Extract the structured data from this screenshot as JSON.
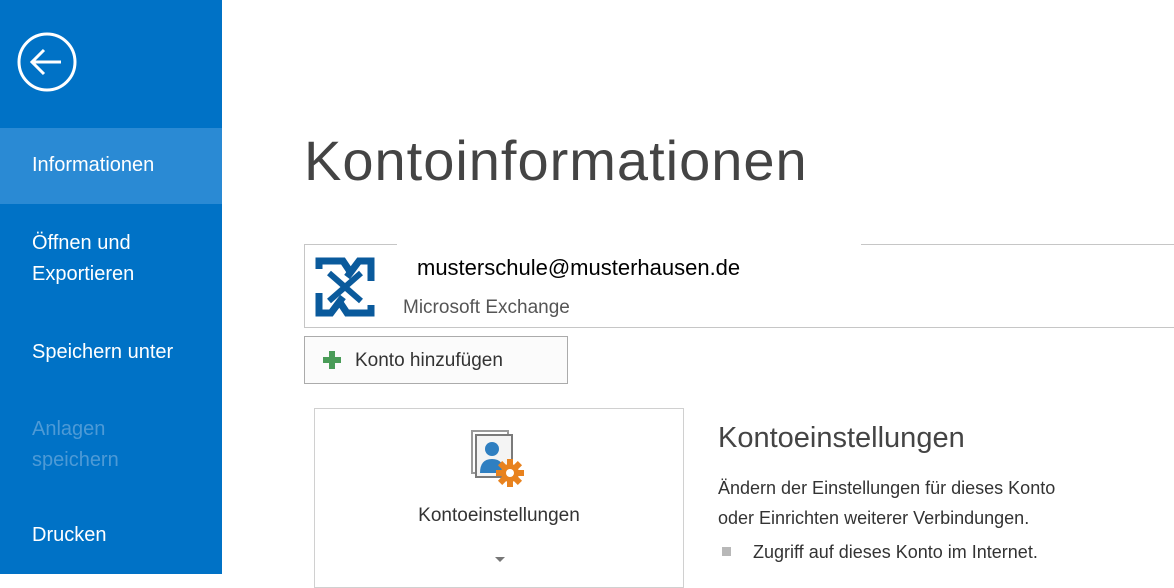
{
  "nav": {
    "back_label": "Zurück",
    "items": [
      {
        "label": "Informationen",
        "selected": true,
        "enabled": true
      },
      {
        "line1": "Öffnen und",
        "line2": "Exportieren",
        "enabled": true
      },
      {
        "label": "Speichern unter",
        "enabled": true
      },
      {
        "line1": "Anlagen",
        "line2": "speichern",
        "enabled": false
      },
      {
        "label": "Drucken",
        "enabled": true
      }
    ]
  },
  "main": {
    "title": "Kontoinformationen",
    "account": {
      "email": "musterschule@musterhausen.de",
      "type": "Microsoft Exchange"
    },
    "add_account_label": "Konto hinzufügen",
    "settings_tile_label": "Kontoeinstellungen",
    "settings_section": {
      "title": "Kontoeinstellungen",
      "description_line1": "Ändern der Einstellungen für dieses Konto",
      "description_line2": "oder Einrichten weiterer Verbindungen.",
      "bullet": "Zugriff auf dieses Konto im Internet."
    }
  },
  "colors": {
    "nav_bg": "#0072c6",
    "nav_selected": "#2a8ad4",
    "nav_disabled_text": "#4d9ad6",
    "add_icon": "#4a9c58",
    "gear_icon": "#e8821e"
  },
  "icons": {
    "back": "back-arrow-circle-icon",
    "exchange": "exchange-logo-icon",
    "add": "plus-icon",
    "settings": "account-settings-gear-icon"
  }
}
